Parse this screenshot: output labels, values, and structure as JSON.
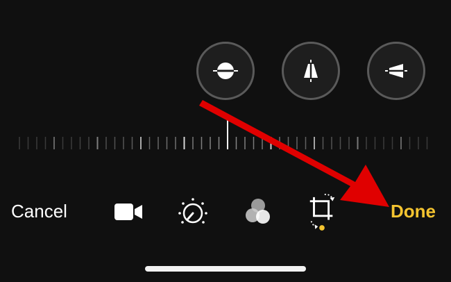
{
  "toolbar": {
    "cancel_label": "Cancel",
    "done_label": "Done"
  },
  "colors": {
    "accent": "#f4c430",
    "annotation_arrow": "#e00000",
    "background": "#101010"
  },
  "icons": {
    "straighten": "straighten-icon",
    "vertical_perspective": "vertical-perspective-icon",
    "horizontal_perspective": "horizontal-perspective-icon",
    "video": "video-camera-icon",
    "adjust": "adjust-dial-icon",
    "filters": "filters-icon",
    "crop": "crop-rotate-icon"
  },
  "ruler": {
    "selected_value": 0
  }
}
